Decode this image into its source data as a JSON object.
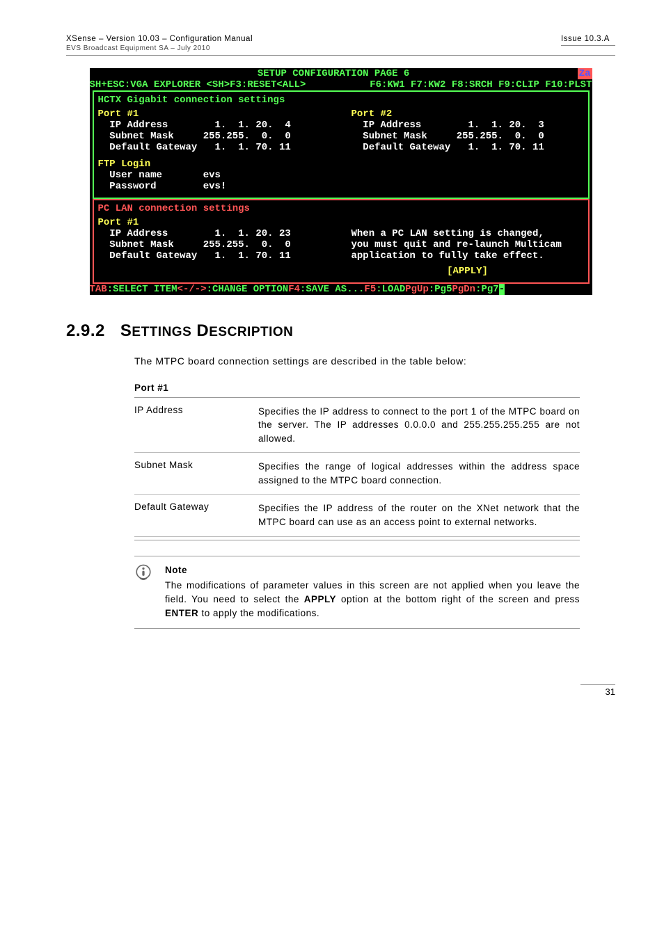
{
  "header": {
    "left_title": "XSense – Version 10.03 – Configuration Manual",
    "left_sub": "EVS Broadcast Equipment SA – July  2010",
    "right": "Issue 10.3.A"
  },
  "terminal": {
    "title": "SETUP CONFIGURATION PAGE 6",
    "za": "Za",
    "fn_left": "SH+ESC:VGA EXPLORER  <SH>F3:RESET<ALL>",
    "fn_right": "F6:KW1 F7:KW2 F8:SRCH F9:CLIP F10:PLST",
    "hctx_title": "HCTX Gigabit connection settings",
    "port1": {
      "hdr": "Port #1",
      "ip": "  IP Address        1.  1. 20.  4",
      "mask": "  Subnet Mask     255.255.  0.  0",
      "gw": "  Default Gateway   1.  1. 70. 11"
    },
    "port2": {
      "hdr": "Port #2",
      "ip": "  IP Address        1.  1. 20.  3",
      "mask": "  Subnet Mask     255.255.  0.  0",
      "gw": "  Default Gateway   1.  1. 70. 11"
    },
    "ftp": {
      "hdr": "FTP Login",
      "user": "  User name       evs",
      "pass": "  Password        evs!"
    },
    "pclan_title": "PC LAN connection settings",
    "pclan_port1": {
      "hdr": "Port #1",
      "ip": "  IP Address        1.  1. 20. 23",
      "mask": "  Subnet Mask     255.255.  0.  0",
      "gw": "  Default Gateway   1.  1. 70. 11"
    },
    "pclan_note1": "When a PC LAN setting is changed,",
    "pclan_note2": "you must quit and re-launch Multicam",
    "pclan_note3": "application to fully take effect.",
    "apply": "[APPLY]",
    "foot": {
      "a1": "TAB",
      "a2": ":SELECT ITEM ",
      "b1": "<-/->",
      "b2": ":CHANGE OPTION ",
      "c1": "F4",
      "c2": ":SAVE AS... ",
      "d1": "F5",
      "d2": ":LOAD  ",
      "e1": "PgUp",
      "e2": ":Pg5  ",
      "f1": "PgDn",
      "f2": ":Pg7  ",
      "dash": "-"
    }
  },
  "section": {
    "num": "2.9.2",
    "title": "SETTINGS DESCRIPTION"
  },
  "intro": "The MTPC board connection settings are described in the table below:",
  "table": {
    "caption": "Port #1",
    "rows": [
      {
        "k": "IP Address",
        "v": "Specifies the IP address to connect to the port 1 of the MTPC board on the server. The IP addresses 0.0.0.0 and 255.255.255.255 are not allowed."
      },
      {
        "k": "Subnet Mask",
        "v": "Specifies the range of logical addresses within the address space assigned to the MTPC board connection."
      },
      {
        "k": "Default Gateway",
        "v": "Specifies the IP address of the router on the XNet network that the MTPC board can use as an access point to external networks."
      }
    ]
  },
  "note": {
    "title": "Note",
    "body_pre": "The modifications of parameter values in this screen are not applied when you leave the field. You need to select the ",
    "apply": "APPLY",
    "body_mid": " option at the bottom right of the screen and press ",
    "enter": "ENTER",
    "body_post": " to apply the modifications."
  },
  "page_number": "31"
}
